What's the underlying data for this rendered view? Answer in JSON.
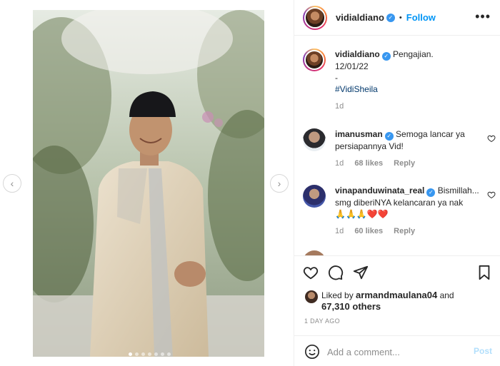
{
  "post": {
    "username": "vidialdiano",
    "separator": "•",
    "follow_label": "Follow",
    "more_icon": "more-horizontal-icon"
  },
  "caption": {
    "username": "vidialdiano",
    "line1": "Pengajian.",
    "line2": "12/01/22",
    "line3": "-",
    "hashtag": "#VidiSheila",
    "age": "1d"
  },
  "comments": [
    {
      "username": "imanusman",
      "text": "Semoga lancar ya persiapannya Vid!",
      "age": "1d",
      "likes": "68 likes",
      "reply_label": "Reply"
    },
    {
      "username": "vinapanduwinata_real",
      "text": "Bismillah... smg diberiNYA kelancaran ya nak",
      "emoji": "🙏🙏🙏❤️❤️",
      "age": "1d",
      "likes": "60 likes",
      "reply_label": "Reply"
    }
  ],
  "likes": {
    "prefix": "Liked by",
    "user": "armandmaulana04",
    "conjunction": "and",
    "others": "67,310 others"
  },
  "timestamp": "1 DAY AGO",
  "comment_box": {
    "placeholder": "Add a comment...",
    "post_label": "Post"
  },
  "carousel": {
    "prev_icon": "chevron-left-icon",
    "next_icon": "chevron-right-icon",
    "prev_glyph": "‹",
    "next_glyph": "›"
  },
  "colors": {
    "accent": "#0095f6",
    "verified": "#3897f0",
    "post_disabled": "#b2dffc",
    "muted": "#8e8e8e"
  }
}
